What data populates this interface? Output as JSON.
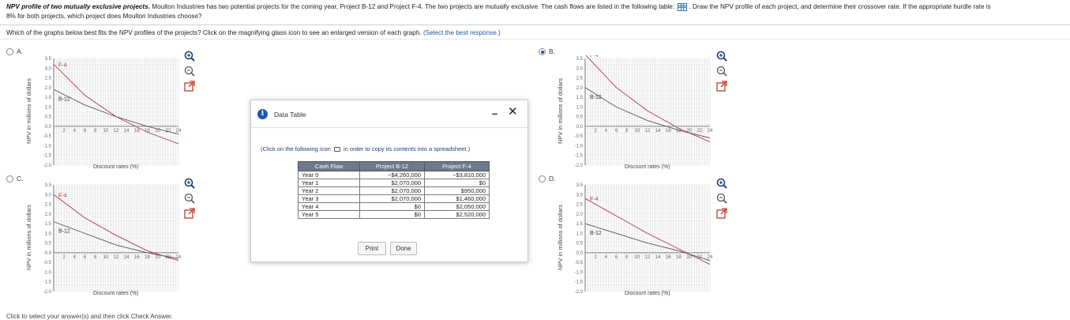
{
  "question": {
    "title": "NPV profile of two mutually exclusive projects.",
    "body_1": "Moulton Industries has two potential projects for the coming year, Project B-12 and Project F-4. The two projects are mutually exclusive. The cash flows are listed in the following table:",
    "body_2": ". Draw the NPV profile of each project, and determine their crossover rate. If the appropriate hurdle rate is",
    "body_3": "8% for both projects, which project does Moulton Industries choose?"
  },
  "prompt": {
    "text": "Which of the graphs below best fits the NPV profiles of the projects? Click on the magnifying glass icon to see an enlarged version of each graph.",
    "hint": "(Select the best response.)"
  },
  "options": [
    {
      "label": "A.",
      "selected": false
    },
    {
      "label": "B.",
      "selected": true
    },
    {
      "label": "C.",
      "selected": false
    },
    {
      "label": "D.",
      "selected": false
    }
  ],
  "graph_common": {
    "ylabel": "NPV in millions of dollars",
    "xlabel": "Discount rates (%)",
    "series_b": "B-12",
    "series_f": "F-4",
    "yticks": [
      "3.5",
      "3.0",
      "2.5",
      "2.0",
      "1.5",
      "1.0",
      "0.5",
      "0.0",
      "-0.5",
      "-1.0",
      "-1.5",
      "-2.0"
    ],
    "xticks": [
      "2",
      "4",
      "6",
      "8",
      "10",
      "12",
      "14",
      "16",
      "18",
      "20",
      "22",
      "24"
    ],
    "colors": {
      "b12": "#555555",
      "f4": "#b03a3a",
      "grid": "#d9d9d9"
    }
  },
  "chart_data": [
    {
      "type": "line",
      "xlabel": "Discount rates (%)",
      "ylabel": "NPV in millions of dollars",
      "ylim": [
        -2.0,
        3.5
      ],
      "xlim": [
        0,
        24
      ],
      "series": [
        {
          "name": "F-4",
          "x": [
            0,
            6,
            12,
            18,
            24
          ],
          "y": [
            3.2,
            1.6,
            0.5,
            -0.3,
            -0.9
          ]
        },
        {
          "name": "B-12",
          "x": [
            0,
            6,
            12,
            18,
            24
          ],
          "y": [
            1.9,
            1.1,
            0.5,
            0.0,
            -0.4
          ]
        }
      ]
    },
    {
      "type": "line",
      "xlabel": "Discount rates (%)",
      "ylabel": "NPV in millions of dollars",
      "ylim": [
        -2.0,
        3.5
      ],
      "xlim": [
        0,
        24
      ],
      "series": [
        {
          "name": "F-4",
          "x": [
            0,
            6,
            12,
            18,
            24
          ],
          "y": [
            3.7,
            2.0,
            0.8,
            -0.1,
            -0.8
          ]
        },
        {
          "name": "B-12",
          "x": [
            0,
            6,
            12,
            18,
            24
          ],
          "y": [
            2.0,
            1.0,
            0.3,
            -0.2,
            -0.6
          ]
        }
      ]
    },
    {
      "type": "line",
      "xlabel": "Discount rates (%)",
      "ylabel": "NPV in millions of dollars",
      "ylim": [
        -2.0,
        3.5
      ],
      "xlim": [
        0,
        24
      ],
      "series": [
        {
          "name": "F-4",
          "x": [
            0,
            6,
            12,
            18,
            24
          ],
          "y": [
            3.0,
            1.8,
            0.9,
            0.1,
            -0.4
          ]
        },
        {
          "name": "B-12",
          "x": [
            0,
            6,
            12,
            18,
            24
          ],
          "y": [
            1.6,
            1.0,
            0.4,
            0.0,
            -0.3
          ]
        }
      ]
    },
    {
      "type": "line",
      "xlabel": "Discount rates (%)",
      "ylabel": "NPV in millions of dollars",
      "ylim": [
        -2.0,
        3.5
      ],
      "xlim": [
        0,
        24
      ],
      "series": [
        {
          "name": "F-4",
          "x": [
            0,
            6,
            12,
            18,
            24
          ],
          "y": [
            2.8,
            1.9,
            1.0,
            0.2,
            -0.6
          ]
        },
        {
          "name": "B-12",
          "x": [
            0,
            6,
            12,
            18,
            24
          ],
          "y": [
            1.5,
            1.0,
            0.5,
            0.1,
            -0.4
          ]
        }
      ]
    }
  ],
  "dialog": {
    "title": "Data Table",
    "minimize": "–",
    "close": "✕",
    "copy_hint_before": "(Click on the following icon",
    "copy_hint_after": "in order to copy its contents into a spreadsheet.)",
    "headers": [
      "Cash Flow",
      "Project B-12",
      "Project F-4"
    ],
    "rows": [
      [
        "Year 0",
        "−$4,260,000",
        "−$3,810,000"
      ],
      [
        "Year 1",
        "$2,070,000",
        "$0"
      ],
      [
        "Year 2",
        "$2,070,000",
        "$950,000"
      ],
      [
        "Year 3",
        "$2,070,000",
        "$1,460,000"
      ],
      [
        "Year 4",
        "$0",
        "$2,050,000"
      ],
      [
        "Year 5",
        "$0",
        "$2,520,000"
      ]
    ],
    "print_label": "Print",
    "done_label": "Done"
  },
  "footer_cut": "Click to select your answer(s) and then click Check Answer."
}
